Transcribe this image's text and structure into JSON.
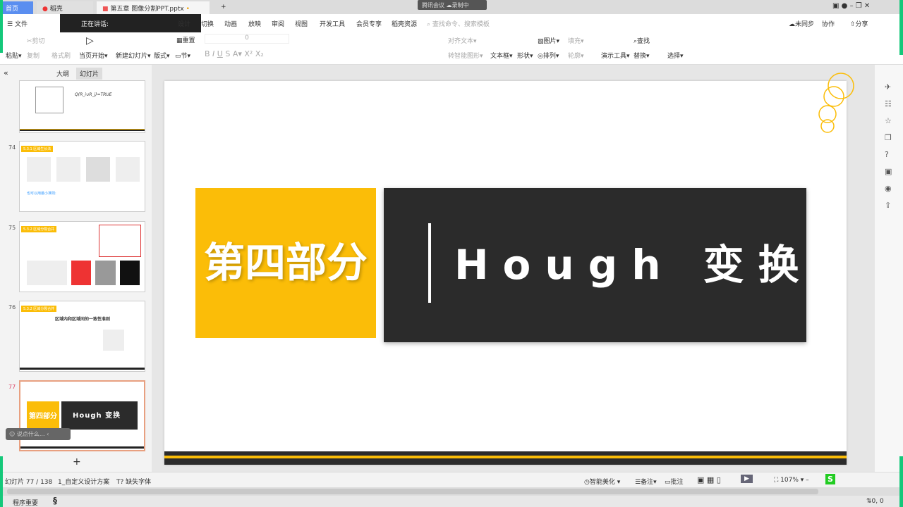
{
  "tabs": {
    "home": "首页",
    "daoke": "稻壳",
    "doc": "第五章 图像分割PPT.pptx",
    "add": "+"
  },
  "meeting": {
    "label": "腾讯会议",
    "recording": "录制中"
  },
  "speaking": {
    "label": "正在讲话:"
  },
  "menu": {
    "file": "文件",
    "items": [
      "设计",
      "切换",
      "动画",
      "放映",
      "审阅",
      "视图",
      "开发工具",
      "会员专享",
      "稻壳资源"
    ],
    "search": "查找命令、搜索模板"
  },
  "top_right": {
    "sync": "未同步",
    "collab": "协作",
    "share": "分享"
  },
  "toolbar": {
    "paste": "粘贴",
    "cut": "剪切",
    "copy": "复制",
    "format_painter": "格式刷",
    "play_current": "当页开始",
    "new_slide": "新建幻灯片",
    "layout": "版式",
    "section": "节",
    "reset": "重置",
    "font_size": "0",
    "text_box": "文本框",
    "shape": "形状",
    "picture": "图片",
    "fill": "填充",
    "arrange": "排列",
    "outline": "轮廓",
    "present_tools": "演示工具",
    "find": "查找",
    "replace": "替换",
    "select": "选择",
    "align_text": "对齐文本",
    "smart_art": "转智能图形"
  },
  "panel": {
    "outline_tab": "大纲",
    "slides_tab": "幻灯片",
    "collapse": "«"
  },
  "thumbnails": [
    {
      "num": "",
      "formula": "Q(R_i∪R_j)=TRUE"
    },
    {
      "num": "74",
      "title": "5.3.1 区域生长法",
      "text": "也可以用最小准则:"
    },
    {
      "num": "75",
      "title": "5.3.2 区域分裂合并"
    },
    {
      "num": "76",
      "title": "5.3.2 区域分裂合并",
      "heading": "区域内和区域间的一致性准则"
    },
    {
      "num": "77",
      "left": "第四部分",
      "right": "Hough 变换"
    }
  ],
  "comment_box": {
    "placeholder": "说点什么..."
  },
  "add_slide": "+",
  "slide": {
    "left_title": "第四部分",
    "right_title": "Hough 变换",
    "colors": {
      "yellow": "#fbbd08",
      "dark": "#2b2b2b"
    }
  },
  "status": {
    "slide_count": "幻灯片 77 / 138",
    "theme": "1_自定义设计方案",
    "missing_font": "缺失字体",
    "beautify": "智能美化",
    "notes": "备注",
    "comments": "批注",
    "zoom": "107%"
  },
  "taskbar": {
    "app": "程序重要",
    "coords": "0, 0"
  }
}
